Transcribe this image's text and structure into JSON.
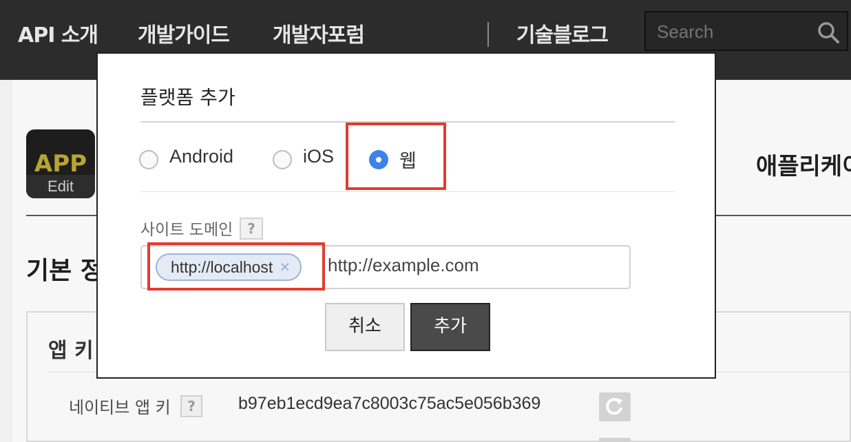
{
  "nav": {
    "items": [
      "API 소개",
      "개발가이드",
      "개발자포럼",
      "기술블로그"
    ],
    "search_placeholder": "Search"
  },
  "page": {
    "app_icon_text": "APP",
    "app_icon_edit": "Edit",
    "app_title": "애플리케이",
    "section_title": "기본 정",
    "keys_title": "앱 키",
    "native_key_label": "네이티브 앱 키",
    "native_key_value": "b97eb1ecd9ea7c8003c75ac5e056b369"
  },
  "modal": {
    "title": "플랫폼 추가",
    "platforms": [
      {
        "label": "Android",
        "selected": false
      },
      {
        "label": "iOS",
        "selected": false
      },
      {
        "label": "웹",
        "selected": true
      }
    ],
    "domain_label": "사이트 도메인",
    "help_glyph": "?",
    "domain_tags": [
      "http://localhost"
    ],
    "domain_placeholder": "http://example.com",
    "cancel_label": "취소",
    "add_label": "추가"
  },
  "colors": {
    "accent_blue": "#3e82e8",
    "highlight_red": "#e33b2e",
    "nav_bg": "#2c2c2c"
  },
  "icons": [
    "search-icon",
    "refresh-icon",
    "remove-tag-icon",
    "help-icon"
  ]
}
